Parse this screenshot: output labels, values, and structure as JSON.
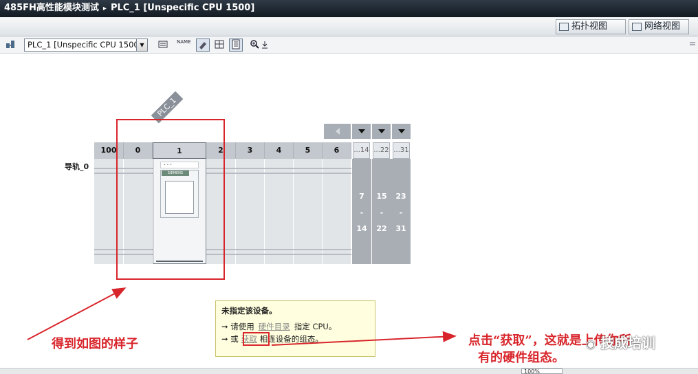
{
  "title_bar": {
    "project": "485FH高性能模块测试",
    "separator": "▸",
    "device": "PLC_1 [Unspecific CPU 1500]"
  },
  "view_tabs": [
    {
      "label": "拓扑视图"
    },
    {
      "label": "网络视图"
    }
  ],
  "toolbar": {
    "device_select": "PLC_1 [Unspecific CPU 1500]",
    "dropdown_arrow": "▼",
    "buttons": [
      {
        "icon": "topology-icon"
      },
      {
        "icon": "device-overview-icon"
      },
      {
        "icon": "show-names-icon",
        "label": "NAME"
      },
      {
        "icon": "paint-icon"
      },
      {
        "icon": "grid-icon"
      },
      {
        "icon": "table-icon"
      },
      {
        "icon": "zoom-icon"
      },
      {
        "icon": "download-icon"
      }
    ]
  },
  "rack": {
    "rail_label": "导轨_0",
    "cpu_tag": "PLC_1",
    "slots": [
      "100",
      "0",
      "1",
      "2",
      "3",
      "4",
      "5",
      "6"
    ],
    "extension_heads": [
      "...14",
      "...22",
      "...31"
    ],
    "extension_ranges": [
      {
        "from": "7",
        "dash": "-",
        "to": "14"
      },
      {
        "from": "15",
        "dash": "-",
        "to": "22"
      },
      {
        "from": "23",
        "dash": "-",
        "to": "31"
      }
    ],
    "cpu_brand": "SIEMENS"
  },
  "info_box": {
    "heading": "未指定该设备。",
    "line1_prefix": "请使用",
    "line1_link": "硬件目录",
    "line1_suffix": "指定 CPU。",
    "line2_prefix": "或",
    "line2_link": "获取",
    "line2_suffix": "相连设备的组态。"
  },
  "annotations": {
    "left": "得到如图的样子",
    "right_line1": "点击“获取”，这就是上传你所",
    "right_line2": "有的硬件组态。"
  },
  "watermark": "技成培训",
  "status": {
    "zoom": "100%"
  },
  "colors": {
    "annotation_red": "#d8252b",
    "title_bar": "#1f2833",
    "info_background": "#ffffdf"
  }
}
